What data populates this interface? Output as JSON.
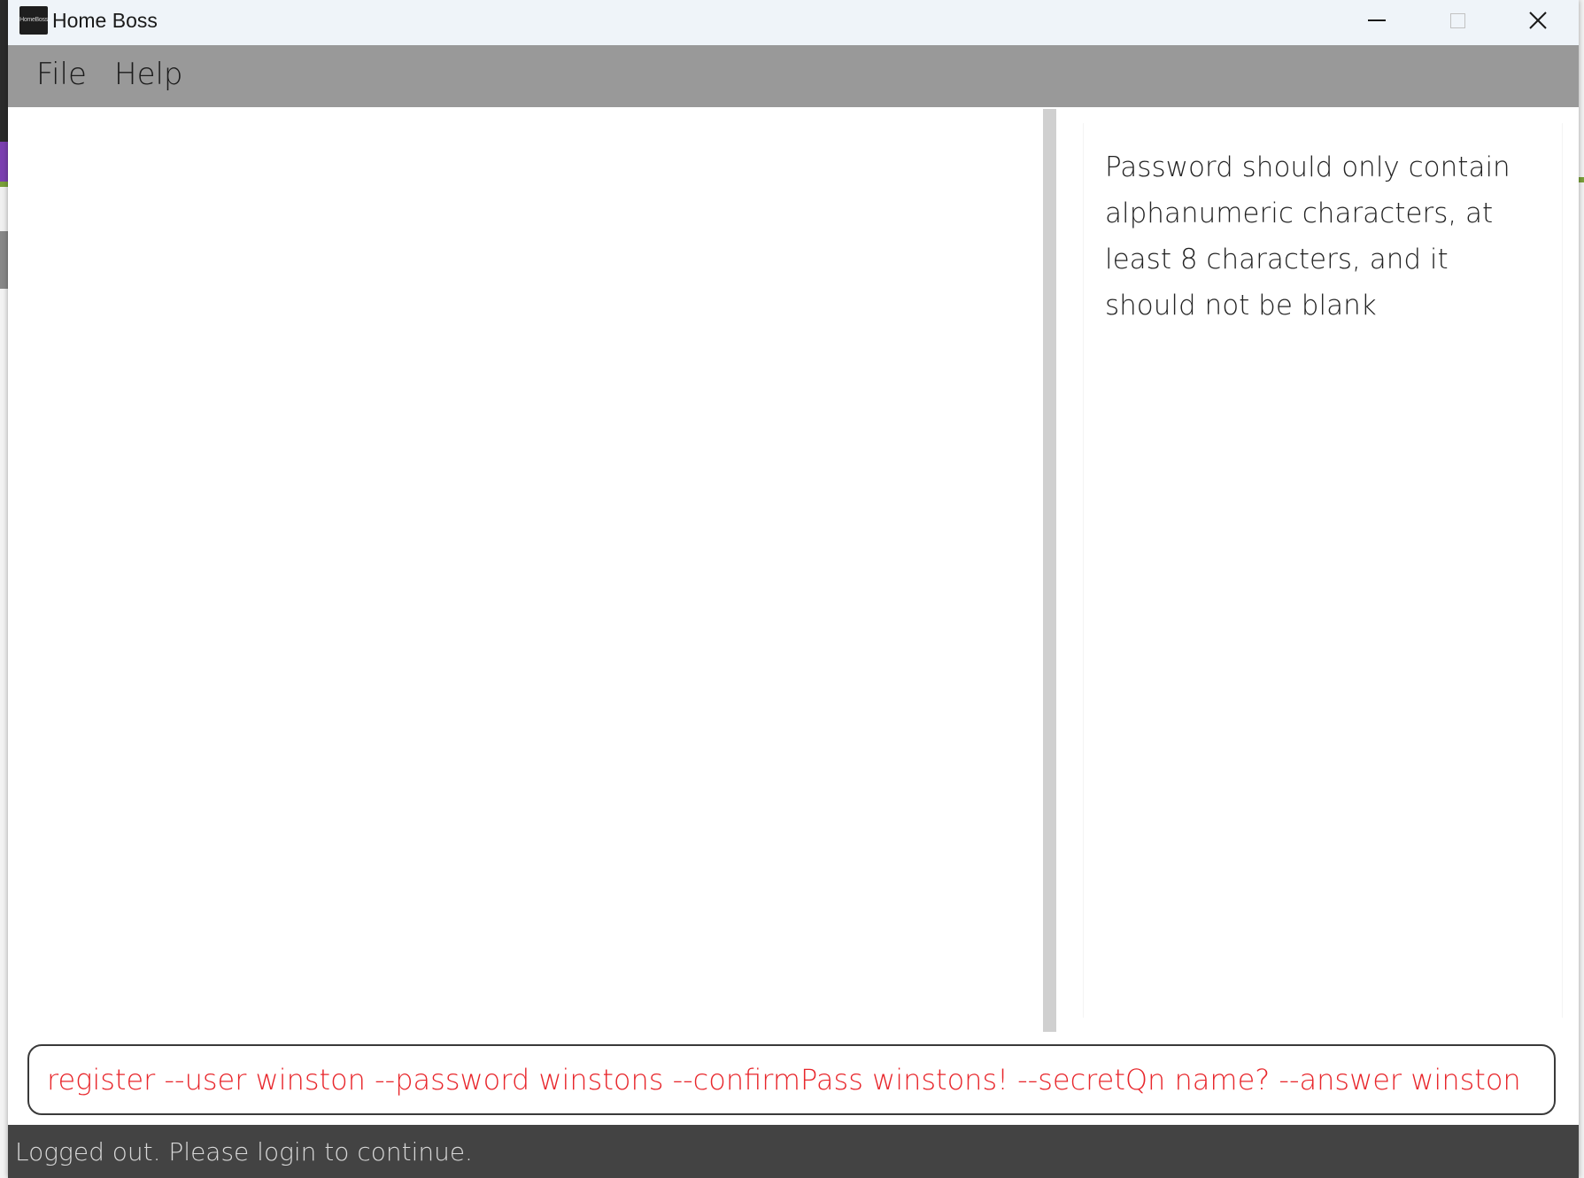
{
  "window": {
    "title": "Home Boss",
    "icon_text": "HomeBoss",
    "controls": {
      "minimize_icon": "minimize-icon",
      "maximize_icon": "maximize-icon",
      "close_icon": "close-icon",
      "close_glyph": "✕"
    }
  },
  "menu": {
    "items": [
      {
        "label": "File"
      },
      {
        "label": "Help"
      }
    ]
  },
  "result": {
    "message": "Password should only contain alphanumeric characters, at least 8 characters, and it should not be blank"
  },
  "command": {
    "value": "register --user winston --password winstons --confirmPass winstons! --secretQn name? --answer winston",
    "error_color": "#e8262b"
  },
  "status": {
    "text": "Logged out. Please login to continue."
  }
}
